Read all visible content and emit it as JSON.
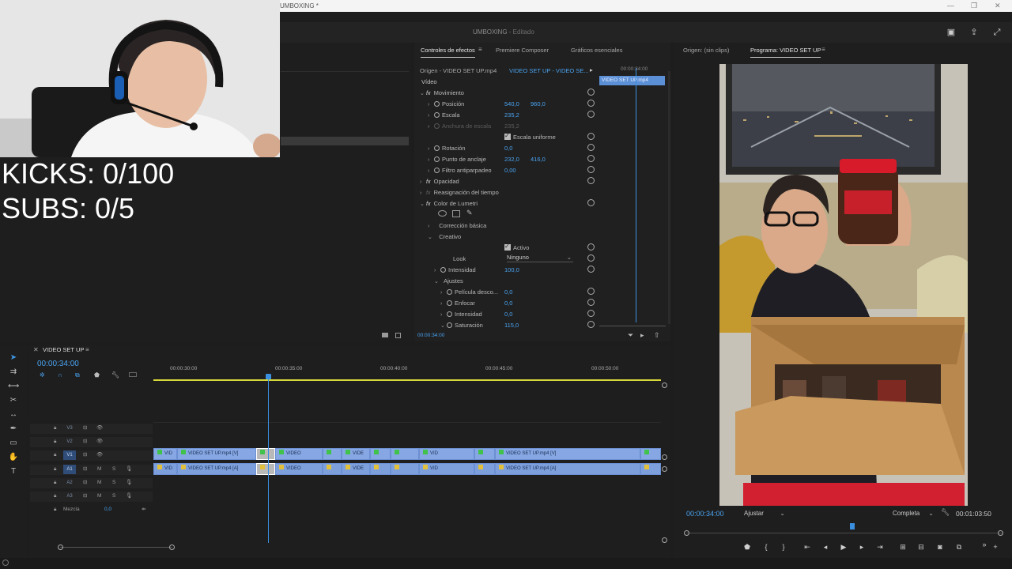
{
  "window": {
    "title": "UMBOXING *",
    "minimize": "—",
    "maximize": "❐",
    "close": "✕"
  },
  "app": {
    "project_title": "UMBOXING",
    "project_status": "- Editado"
  },
  "overlay": {
    "kicks": "KICKS: 0/100",
    "subs": "SUBS: 0/5"
  },
  "effect_controls": {
    "tabs": [
      "Controles de efectos",
      "Premiere Composer",
      "Gráficos esenciales"
    ],
    "source": "Origen - VIDEO SET UP.mp4",
    "sequence": "VIDEO SET UP - VIDEO SE...",
    "mini_timecode": "00:00:34:00",
    "mini_clip": "VIDEO SET UP.mp4",
    "section_video": "Vídeo",
    "rows": {
      "movimiento": "Movimiento",
      "posicion": "Posición",
      "posicion_x": "540,0",
      "posicion_y": "960,0",
      "escala": "Escala",
      "escala_val": "235,2",
      "ancho": "Anchura de escala",
      "ancho_val": "235,2",
      "escala_uniforme": "Escala uniforme",
      "rotacion": "Rotación",
      "rotacion_val": "0,0",
      "anclaje": "Punto de anclaje",
      "anclaje_x": "232,0",
      "anclaje_y": "416,0",
      "filtro": "Filtro antiparpadeo",
      "filtro_val": "0,00",
      "opacidad": "Opacidad",
      "reasignacion": "Reasignación del tiempo",
      "lumetri": "Color de Lumetri",
      "correccion": "Corrección básica",
      "creativo": "Creativo",
      "activo": "Activo",
      "look": "Look",
      "look_val": "Ninguno",
      "intensidad": "Intensidad",
      "intensidad_val": "100,0",
      "ajustes": "Ajustes",
      "pelicula": "Película desco...",
      "pelicula_val": "0,0",
      "enfocar": "Enfocar",
      "enfocar_val": "0,0",
      "intensidad2": "Intensidad",
      "intensidad2_val": "0,0",
      "saturacion": "Saturación",
      "saturacion_val": "115,0"
    },
    "footer_timecode": "00:00:34:00"
  },
  "program": {
    "tab_origin": "Origen: (sin clips)",
    "tab_program": "Programa: VIDEO SET UP",
    "timecode": "00:00:34:00",
    "fit": "Ajustar",
    "quality": "Completa",
    "duration": "00:01:03:50"
  },
  "timeline": {
    "sequence_name": "VIDEO SET UP",
    "timecode": "00:00:34:00",
    "ruler": [
      "00:00:30:00",
      "00:00:35:00",
      "00:00:40:00",
      "00:00:45:00",
      "00:00:50:00"
    ],
    "tracks": {
      "v3": "V3",
      "v2": "V2",
      "v1": "V1",
      "a1": "A1",
      "a2": "A2",
      "a3": "A3",
      "mix": "Mezcla",
      "mix_val": "0,0"
    },
    "video_clips": [
      "VID",
      "VIDEO SET UP.mp4 [V]",
      "",
      "VIDEO",
      "",
      "VIDE",
      "",
      "",
      "VID",
      "",
      "VIDEO SET UP.mp4 [V]",
      ""
    ],
    "audio_clips": [
      "VID",
      "VIDEO SET UP.mp4 [A]",
      "",
      "VIDEO",
      "",
      "VIDE",
      "",
      "",
      "VID",
      "",
      "VIDEO SET UP.mp4 [A]",
      ""
    ]
  }
}
